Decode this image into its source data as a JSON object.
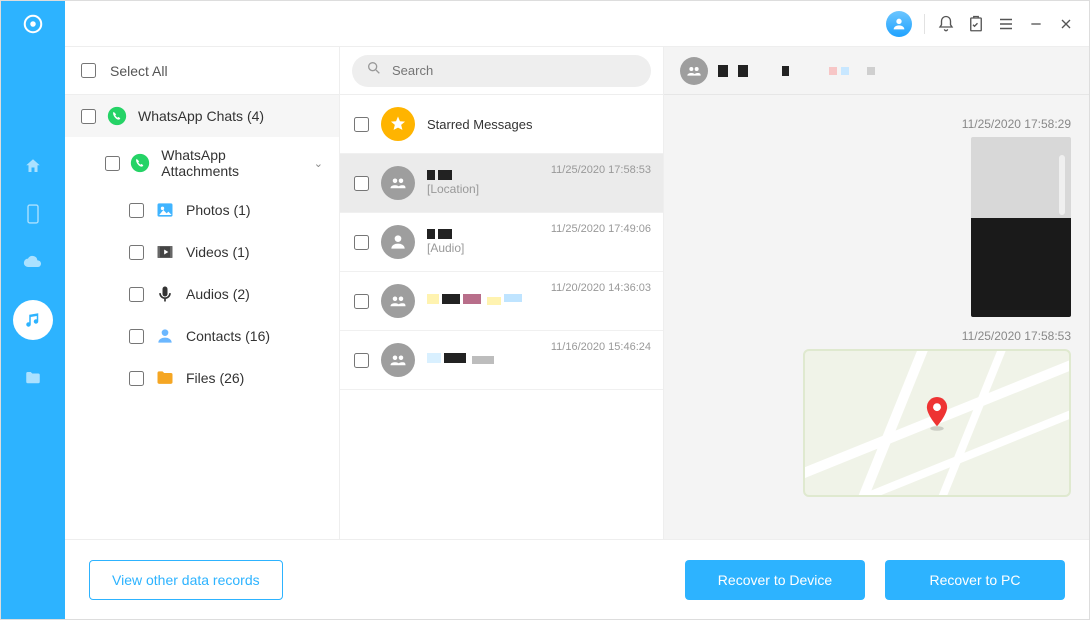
{
  "sidebar": {
    "select_all": "Select All",
    "whatsapp_chats": {
      "label": "WhatsApp Chats",
      "count": 4
    },
    "whatsapp_attachments": {
      "label": "WhatsApp Attachments"
    },
    "items": [
      {
        "icon": "photos",
        "label": "Photos",
        "count": 1
      },
      {
        "icon": "videos",
        "label": "Videos",
        "count": 1
      },
      {
        "icon": "audios",
        "label": "Audios",
        "count": 2
      },
      {
        "icon": "contacts",
        "label": "Contacts",
        "count": 16
      },
      {
        "icon": "files",
        "label": "Files",
        "count": 26
      }
    ]
  },
  "search": {
    "placeholder": "Search"
  },
  "chats": {
    "starred_label": "Starred Messages",
    "list": [
      {
        "sub": "[Location]",
        "ts": "11/25/2020 17:58:53",
        "selected": true
      },
      {
        "sub": "[Audio]",
        "ts": "11/25/2020 17:49:06"
      },
      {
        "sub": "",
        "ts": "11/20/2020 14:36:03"
      },
      {
        "sub": "",
        "ts": "11/16/2020 15:46:24"
      }
    ]
  },
  "conversation": {
    "msgs": [
      {
        "type": "photo",
        "ts": "11/25/2020 17:58:29"
      },
      {
        "type": "map",
        "ts": "11/25/2020 17:58:53"
      }
    ]
  },
  "footer": {
    "view_other": "View other data records",
    "recover_device": "Recover to Device",
    "recover_pc": "Recover to PC"
  },
  "colors": {
    "accent": "#2db3ff"
  }
}
